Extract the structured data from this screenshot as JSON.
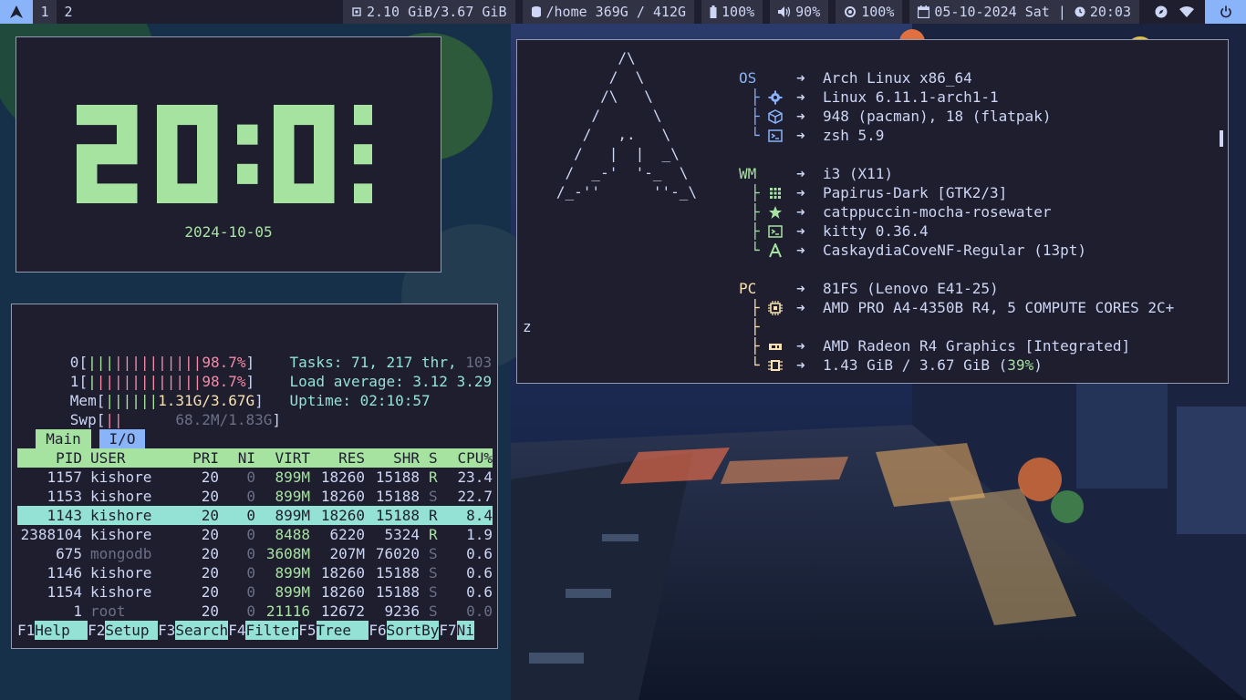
{
  "topbar": {
    "workspaces": [
      "1",
      "2"
    ],
    "memory": "2.10 GiB/3.67 GiB",
    "disk": "/home 369G / 412G",
    "battery": "100%",
    "volume": "90%",
    "brightness": "100%",
    "date": "05-10-2024 Sat",
    "separator": "|",
    "time": "20:03",
    "colors": {
      "bar_bg": "#1e1e2e",
      "module_bg": "#313244",
      "accent": "#89b4fa"
    }
  },
  "clock": {
    "time": "20:03",
    "date": "2024-10-05",
    "color": "#a6e3a1"
  },
  "fetch": {
    "ascii_logo": "      /\\\n     /  \\\n    /\\   \\\n   /      \\\n  /   ,,   \\\n /   |  |  -\\\n/_-''    ''-_\\",
    "ascii_lines": [
      "         /\\",
      "        /  \\",
      "       /\\   \\",
      "      /      \\",
      "     /   ,,   \\",
      "    /   |  |   \\",
      "   /   _|  |_   \\",
      "  /_-''      ''-_\\"
    ],
    "prompt": "z",
    "arrow": "➜",
    "sections": [
      {
        "key": "OS",
        "key_color": "#89b4fa",
        "tree_color": "#89b4fa",
        "rows": [
          {
            "icon": "",
            "value": "Arch Linux x86_64"
          },
          {
            "icon": "gear-icon",
            "value": "Linux 6.11.1-arch1-1"
          },
          {
            "icon": "package-icon",
            "value": "948 (pacman), 18 (flatpak)"
          },
          {
            "icon": "terminal-icon",
            "value": "zsh 5.9"
          }
        ]
      },
      {
        "key": "WM",
        "key_color": "#a6e3a1",
        "tree_color": "#a6e3a1",
        "rows": [
          {
            "icon": "",
            "value": "i3 (X11)"
          },
          {
            "icon": "grid-icon",
            "value": "Papirus-Dark [GTK2/3]"
          },
          {
            "icon": "star-icon",
            "value": "catppuccin-mocha-rosewater"
          },
          {
            "icon": "terminal-icon",
            "value": "kitty 0.36.4"
          },
          {
            "icon": "font-icon",
            "value": "CaskaydiaCoveNF-Regular (13pt)"
          }
        ]
      },
      {
        "key": "PC",
        "key_color": "#f9e2af",
        "tree_color": "#f9e2af",
        "rows": [
          {
            "icon": "",
            "value": "81FS (Lenovo E41-25)"
          },
          {
            "icon": "cpu-icon",
            "value": "AMD PRO A4-4350B R4, 5 COMPUTE CORES 2C+"
          },
          {
            "icon": "",
            "value": ""
          },
          {
            "icon": "gpu-icon",
            "value": "AMD Radeon R4 Graphics [Integrated]"
          },
          {
            "icon": "memory-chip-icon",
            "value": "1.43 GiB / 3.67 GiB (",
            "value_pct": "39%",
            "value_end": ")"
          }
        ]
      }
    ]
  },
  "htop": {
    "cpu0_label": "0",
    "cpu0_pct": "98.7%",
    "cpu1_label": "1",
    "cpu1_pct": "98.7%",
    "mem_label": "Mem",
    "mem_value": "1.31G/3.67G",
    "swp_label": "Swp",
    "swp_value": "68.2M/1.83G",
    "tasks_label": "Tasks:",
    "tasks_value": "71,",
    "threads_value": "217 thr,",
    "kthreads_value": "103",
    "load_label": "Load average:",
    "load_values": "3.12 3.29",
    "uptime_label": "Uptime:",
    "uptime_value": "02:10:57",
    "tabs": [
      "Main",
      "I/O"
    ],
    "columns": [
      "PID",
      "USER",
      "PRI",
      "NI",
      "VIRT",
      "RES",
      "SHR",
      "S",
      "CPU%"
    ],
    "rows": [
      {
        "pid": "1157",
        "user": "kishore",
        "pri": "20",
        "ni": "0",
        "virt": "899M",
        "res": "18260",
        "shr": "15188",
        "s": "R",
        "cpu": "23.4"
      },
      {
        "pid": "1153",
        "user": "kishore",
        "pri": "20",
        "ni": "0",
        "virt": "899M",
        "res": "18260",
        "shr": "15188",
        "s": "S",
        "cpu": "22.7"
      },
      {
        "pid": "1143",
        "user": "kishore",
        "pri": "20",
        "ni": "0",
        "virt": "899M",
        "res": "18260",
        "shr": "15188",
        "s": "R",
        "cpu": "8.4",
        "selected": true
      },
      {
        "pid": "2388104",
        "user": "kishore",
        "pri": "20",
        "ni": "0",
        "virt": "8488",
        "res": "6220",
        "shr": "5324",
        "s": "R",
        "cpu": "1.9"
      },
      {
        "pid": "675",
        "user": "mongodb",
        "pri": "20",
        "ni": "0",
        "virt": "3608M",
        "res": "207M",
        "shr": "76020",
        "s": "S",
        "cpu": "0.6"
      },
      {
        "pid": "1146",
        "user": "kishore",
        "pri": "20",
        "ni": "0",
        "virt": "899M",
        "res": "18260",
        "shr": "15188",
        "s": "S",
        "cpu": "0.6"
      },
      {
        "pid": "1154",
        "user": "kishore",
        "pri": "20",
        "ni": "0",
        "virt": "899M",
        "res": "18260",
        "shr": "15188",
        "s": "S",
        "cpu": "0.6"
      },
      {
        "pid": "1",
        "user": "root",
        "pri": "20",
        "ni": "0",
        "virt": "21116",
        "res": "12672",
        "shr": "9236",
        "s": "S",
        "cpu": "0.0"
      }
    ],
    "fkeys": [
      {
        "key": "F1",
        "label": "Help  "
      },
      {
        "key": "F2",
        "label": "Setup "
      },
      {
        "key": "F3",
        "label": "Search"
      },
      {
        "key": "F4",
        "label": "Filter"
      },
      {
        "key": "F5",
        "label": "Tree  "
      },
      {
        "key": "F6",
        "label": "SortBy"
      },
      {
        "key": "F7",
        "label": "Ni"
      }
    ]
  }
}
